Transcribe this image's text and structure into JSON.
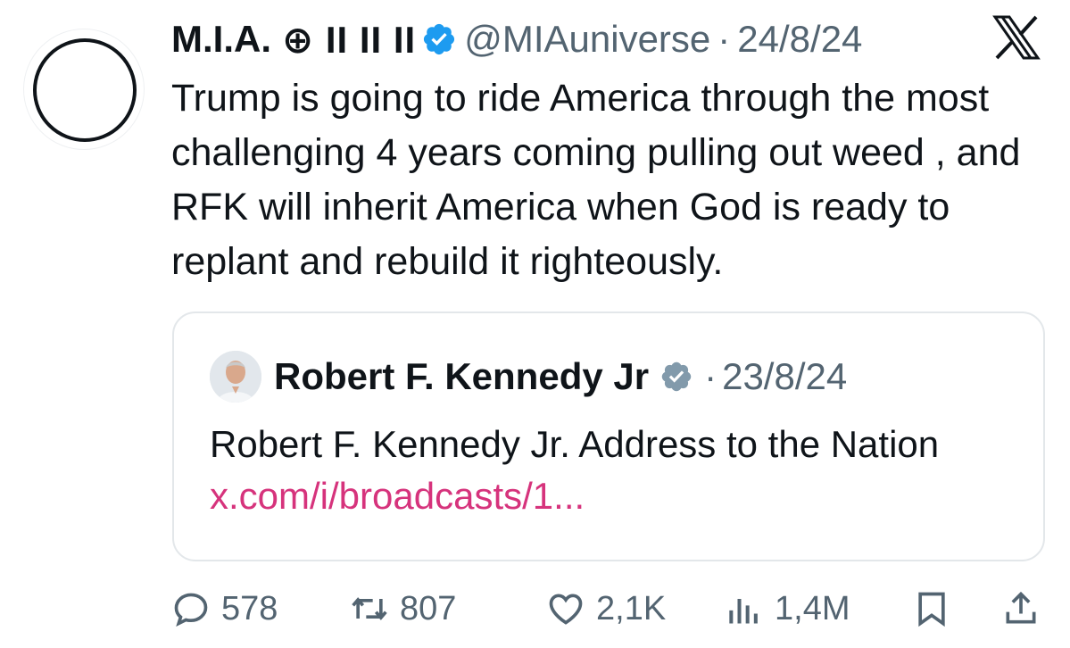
{
  "tweet": {
    "author_name": "M.I.A.",
    "name_symbols": "⊕ II II II",
    "handle": "@MIAuniverse",
    "separator": "·",
    "date": "24/8/24",
    "text": "Trump is going to ride America through the most challenging 4 years coming pulling out weed , and RFK will inherit America when God is ready to replant and rebuild it righteously."
  },
  "quoted": {
    "author_name": "Robert F. Kennedy Jr",
    "separator": "·",
    "date": "23/8/24",
    "text": "Robert F. Kennedy Jr. Address to the Nation",
    "link": "x.com/i/broadcasts/1..."
  },
  "metrics": {
    "replies": "578",
    "reposts": "807",
    "likes": "2,1K",
    "views": "1,4M"
  },
  "icons": [
    "verified-badge-icon",
    "x-logo-icon",
    "reply-icon",
    "repost-icon",
    "like-icon",
    "views-icon",
    "bookmark-icon",
    "share-icon"
  ],
  "colors": {
    "text": "#0f1419",
    "muted": "#536471",
    "verified": "#1d9bf0",
    "link": "#d6337c",
    "border": "#e3e7ea"
  }
}
